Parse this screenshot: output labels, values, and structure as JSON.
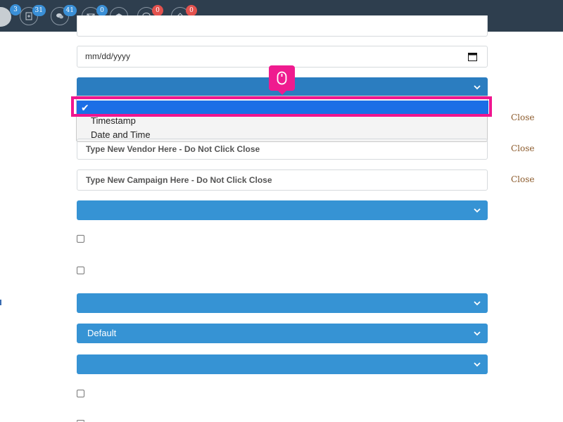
{
  "topbar": {
    "items": [
      {
        "icon": "file-icon",
        "badge": "3",
        "badge_color": "#3a8fd6"
      },
      {
        "icon": "add-document-icon",
        "badge": "31",
        "badge_color": "#3a8fd6"
      },
      {
        "icon": "chat-icon",
        "badge": "41",
        "badge_color": "#3a8fd6"
      },
      {
        "icon": "envelope-icon",
        "badge": "0",
        "badge_color": "#3a8fd6"
      },
      {
        "icon": "open-envelope-icon",
        "badge": "",
        "badge_color": ""
      },
      {
        "icon": "comment-icon",
        "badge": "0",
        "badge_color": "#e3524e"
      },
      {
        "icon": "ticket-icon",
        "badge": "0",
        "badge_color": "#e3524e"
      }
    ]
  },
  "form": {
    "date_field": {
      "placeholder": "mm/dd/yyyy"
    },
    "date_format_select": {
      "selected": "",
      "options": [
        {
          "label": "",
          "selected": true,
          "check": "✔"
        },
        {
          "label": "Timestamp",
          "selected": false
        },
        {
          "label": "Date and Time",
          "selected": false
        }
      ]
    },
    "vendor_input": {
      "placeholder": "Type New Vendor Here - Do Not Click Close"
    },
    "campaign_input": {
      "placeholder": "Type New Campaign Here - Do Not Click Close"
    },
    "close_label": "Close",
    "select_2": {
      "value": ""
    },
    "select_3": {
      "value": ""
    },
    "select_4": {
      "value": "Default"
    },
    "select_5": {
      "value": ""
    },
    "checkboxes": [
      false,
      false,
      false
    ]
  },
  "colors": {
    "topbar": "#2e3e4e",
    "select_blue": "#3693d4",
    "highlight": "#f0158f",
    "selected_option": "#1b6ee6",
    "close_link": "#8b5a2b"
  }
}
